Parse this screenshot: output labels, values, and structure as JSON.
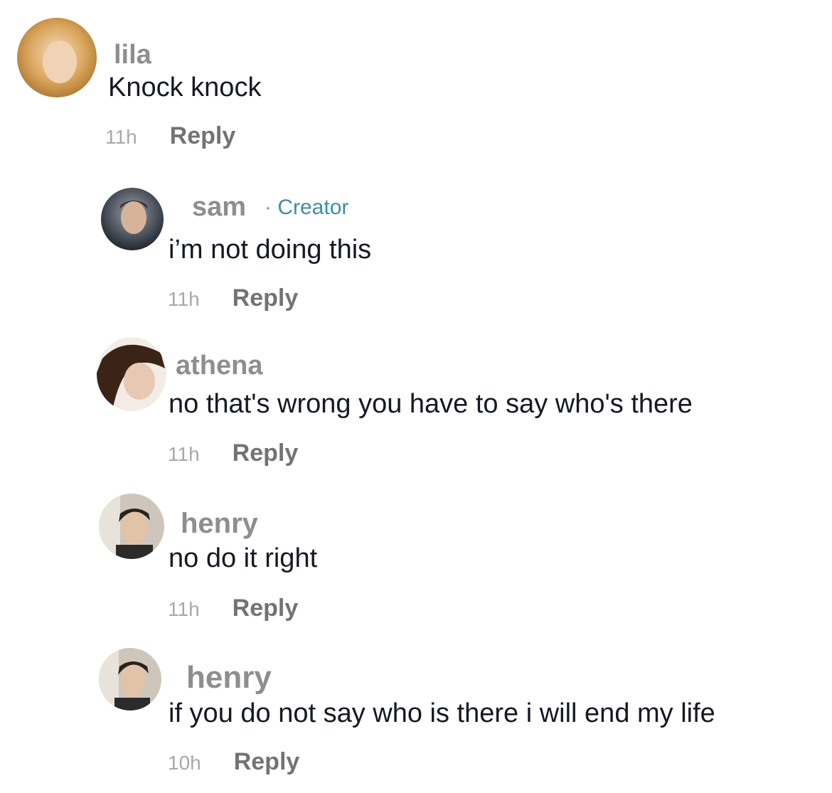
{
  "comments": [
    {
      "username": "lila",
      "text": "Knock knock",
      "time": "11h",
      "reply_label": "Reply",
      "avatar_colors": [
        "#f4d9a8",
        "#c9913f"
      ]
    },
    {
      "username": "sam",
      "creator_badge": "Creator",
      "creator_sep": "·",
      "text": "i’m not doing this",
      "time": "11h",
      "reply_label": "Reply",
      "avatar_colors": [
        "#6b7380",
        "#20242b"
      ]
    },
    {
      "username": "athena",
      "text": "no that's wrong you have to say who's there",
      "time": "11h",
      "reply_label": "Reply",
      "avatar_colors": [
        "#f0e6dc",
        "#3a2418"
      ]
    },
    {
      "username": "henry",
      "text": "no do it right",
      "time": "11h",
      "reply_label": "Reply",
      "avatar_colors": [
        "#d8c5b0",
        "#2a221d"
      ]
    },
    {
      "username": "henry",
      "text": "if you do not say who is there i will end my life",
      "time": "10h",
      "reply_label": "Reply",
      "avatar_colors": [
        "#d8c5b0",
        "#2a221d"
      ]
    }
  ],
  "colors": {
    "username": "#8e8e8e",
    "text": "#161823",
    "time": "#a8a8a8",
    "reply": "#737373",
    "creator": "#3b8fa6"
  }
}
